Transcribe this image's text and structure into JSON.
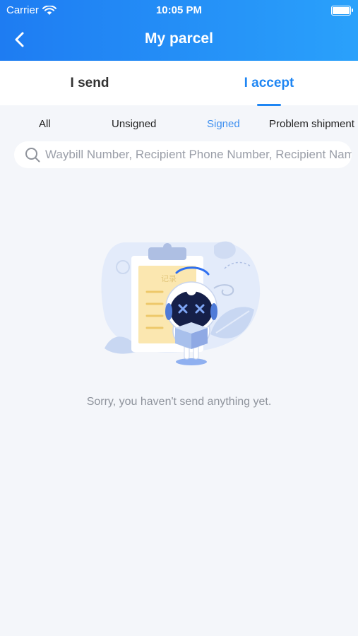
{
  "status_bar": {
    "carrier": "Carrier",
    "time": "10:05 PM"
  },
  "nav": {
    "title": "My parcel",
    "back_icon": "chevron-left-icon"
  },
  "main_tabs": [
    {
      "label": "I send",
      "active": false
    },
    {
      "label": "I accept",
      "active": true
    }
  ],
  "sub_tabs": [
    {
      "label": "All",
      "active": false
    },
    {
      "label": "Unsigned",
      "active": false
    },
    {
      "label": "Signed",
      "active": true
    },
    {
      "label": "Problem shipment",
      "active": false
    }
  ],
  "search": {
    "value": "",
    "placeholder": "Waybill Number, Recipient Phone Number, Recipient Name"
  },
  "empty_state": {
    "message": "Sorry, you haven't send anything yet.",
    "illustration_label": "记录"
  },
  "colors": {
    "header_gradient_start": "#1e7cf2",
    "header_gradient_end": "#2aa1fb",
    "accent": "#1f86f3",
    "background": "#f4f6fa"
  }
}
